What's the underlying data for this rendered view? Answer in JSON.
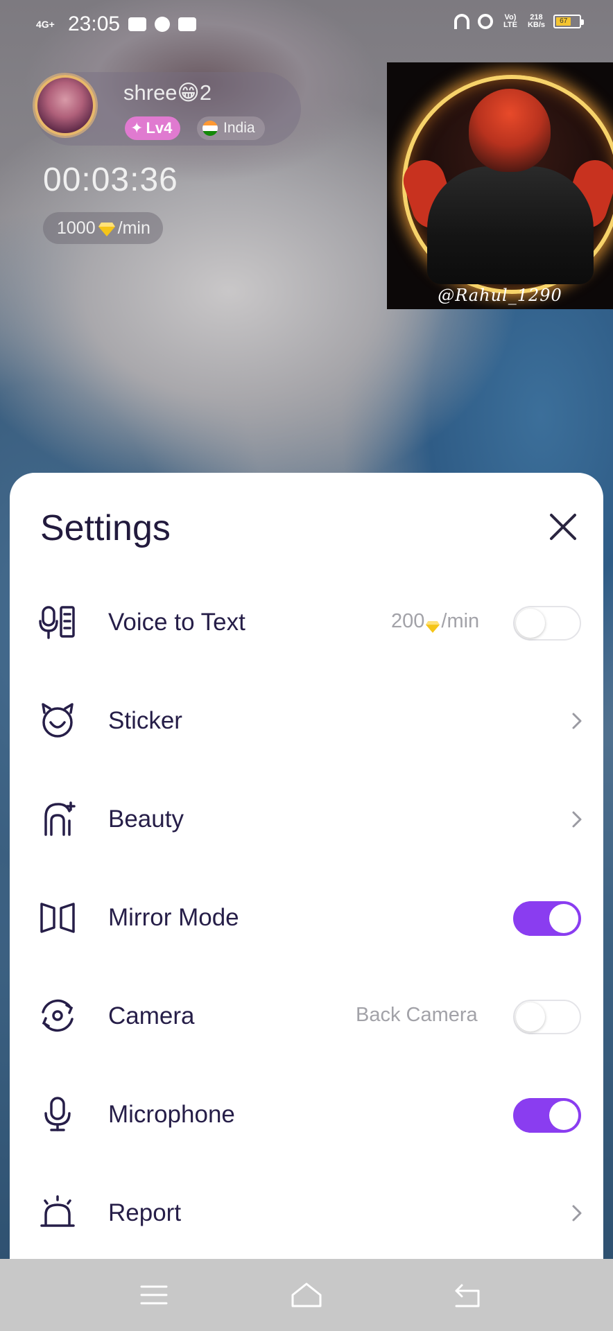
{
  "status_bar": {
    "network": "4G+",
    "time": "23:05",
    "volte": "Vo) LTE",
    "speed_value": "218",
    "speed_unit": "KB/s",
    "battery": "67"
  },
  "caller": {
    "name": "shree😁2",
    "level": "Lv4",
    "country": "India",
    "call_timer": "00:03:36",
    "rate_amount": "1000",
    "rate_unit": "/min"
  },
  "self_view": {
    "label": "@Rahul_1290"
  },
  "settings": {
    "title": "Settings",
    "items": [
      {
        "label": "Voice to Text",
        "icon": "voice-to-text-icon",
        "hint_amount": "200",
        "hint_unit": "/min",
        "control": "toggle",
        "on": false
      },
      {
        "label": "Sticker",
        "icon": "sticker-icon",
        "control": "chevron"
      },
      {
        "label": "Beauty",
        "icon": "beauty-icon",
        "control": "chevron"
      },
      {
        "label": "Mirror Mode",
        "icon": "mirror-mode-icon",
        "control": "toggle",
        "on": true
      },
      {
        "label": "Camera",
        "icon": "camera-switch-icon",
        "hint": "Back Camera",
        "control": "toggle",
        "on": false
      },
      {
        "label": "Microphone",
        "icon": "microphone-icon",
        "control": "toggle",
        "on": true
      },
      {
        "label": "Report",
        "icon": "alarm-report-icon",
        "control": "chevron"
      }
    ]
  },
  "nav_bar": {
    "buttons": [
      "menu-icon",
      "home-icon",
      "back-icon"
    ]
  },
  "colors": {
    "accent": "#8a3df0",
    "text_primary": "#261e48",
    "hint": "#a2a2a8",
    "level_badge": "#e07ad0",
    "gem": "#f5c518"
  }
}
